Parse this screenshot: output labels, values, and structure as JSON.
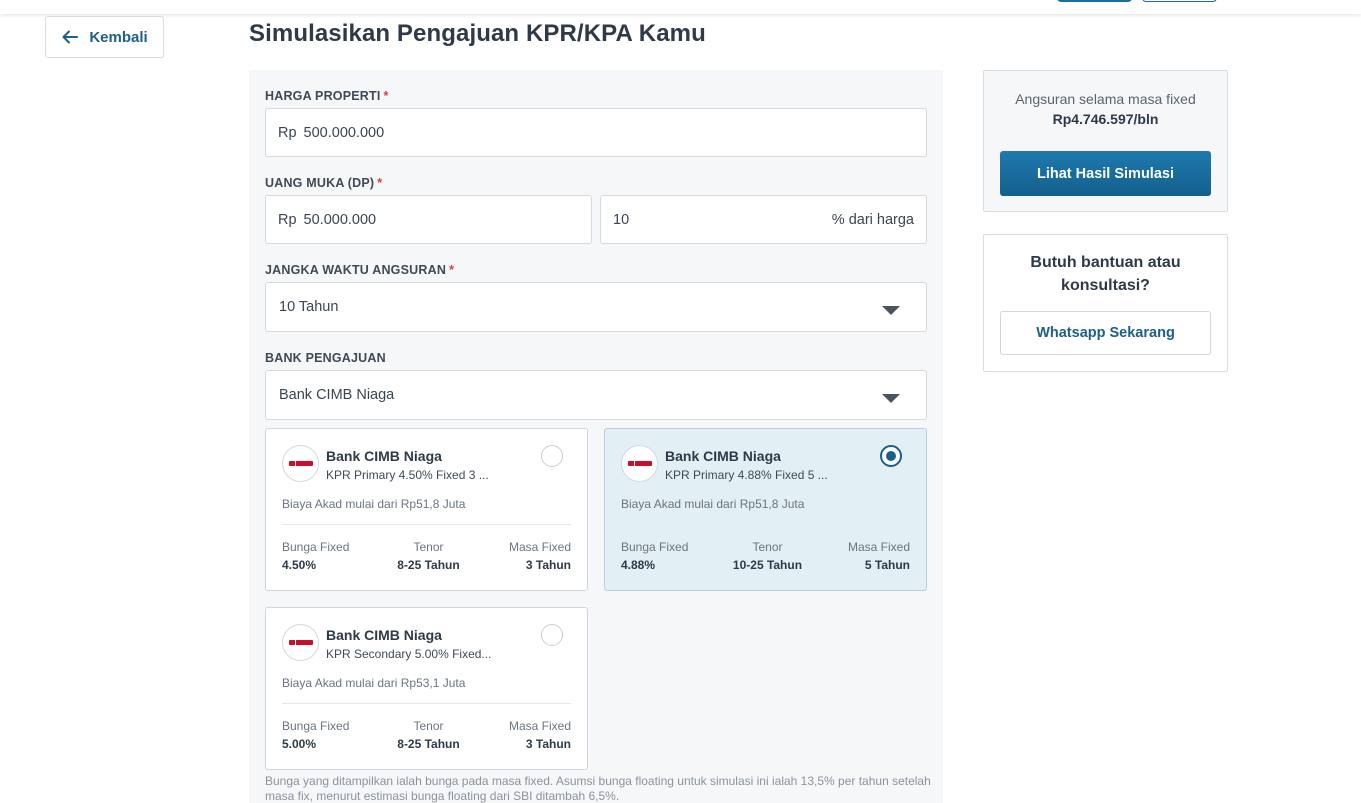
{
  "back": {
    "label": "Kembali"
  },
  "page_title": "Simulasikan Pengajuan KPR/KPA Kamu",
  "form": {
    "harga": {
      "label": "HARGA PROPERTI",
      "required": "*",
      "prefix": "Rp",
      "value": "500.000.000"
    },
    "dp": {
      "label": "UANG MUKA (DP)",
      "required": "*",
      "prefix": "Rp",
      "value": "50.000.000",
      "percent_value": "10",
      "percent_suffix": "% dari harga"
    },
    "jangka": {
      "label": "JANGKA WAKTU ANGSURAN",
      "required": "*",
      "selected": "10 Tahun"
    },
    "bank": {
      "label": "BANK PENGAJUAN",
      "selected": "Bank CIMB Niaga"
    }
  },
  "bank_cards": [
    {
      "bank": "Bank CIMB Niaga",
      "product": "KPR Primary 4.50% Fixed 3 ...",
      "biaya": "Biaya Akad mulai dari Rp51,8 Juta",
      "bunga_label": "Bunga Fixed",
      "bunga": "4.50%",
      "tenor_label": "Tenor",
      "tenor": "8-25 Tahun",
      "masa_label": "Masa Fixed",
      "masa": "3 Tahun",
      "selected": false
    },
    {
      "bank": "Bank CIMB Niaga",
      "product": "KPR Primary 4.88% Fixed 5 ...",
      "biaya": "Biaya Akad mulai dari Rp51,8 Juta",
      "bunga_label": "Bunga Fixed",
      "bunga": "4.88%",
      "tenor_label": "Tenor",
      "tenor": "10-25 Tahun",
      "masa_label": "Masa Fixed",
      "masa": "5 Tahun",
      "selected": true
    },
    {
      "bank": "Bank CIMB Niaga",
      "product": "KPR Secondary 5.00% Fixed...",
      "biaya": "Biaya Akad mulai dari Rp53,1 Juta",
      "bunga_label": "Bunga Fixed",
      "bunga": "5.00%",
      "tenor_label": "Tenor",
      "tenor": "8-25 Tahun",
      "masa_label": "Masa Fixed",
      "masa": "3 Tahun",
      "selected": false
    }
  ],
  "footnote": "Bunga yang ditampilkan ialah bunga pada masa fixed. Asumsi bunga floating untuk simulasi ini ialah 13,5% per tahun setelah masa fix, menurut estimasi bunga floating dari SBI ditambah 6,5%.",
  "summary": {
    "caption": "Angsuran selama masa fixed",
    "amount": "Rp4.746.597/bln",
    "button": "Lihat Hasil Simulasi"
  },
  "help": {
    "title": "Butuh bantuan atau konsultasi?",
    "button": "Whatsapp Sekarang"
  },
  "colors": {
    "primary": "#1a6fa1",
    "selected_card_bg": "#e2eff5",
    "required": "#e03a3a"
  }
}
